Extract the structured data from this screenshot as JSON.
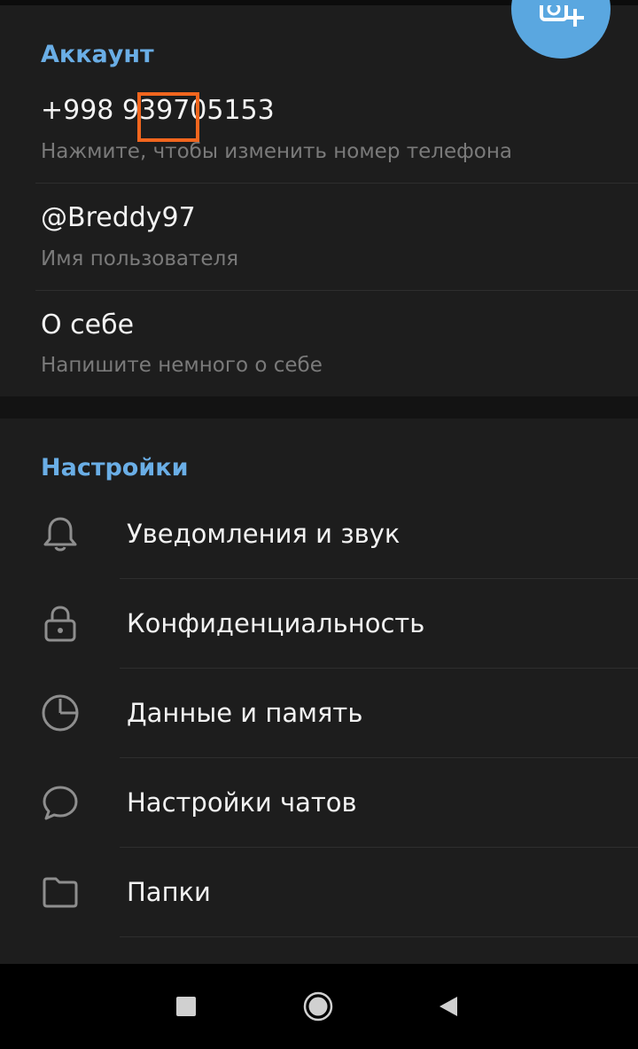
{
  "account": {
    "header": "Аккаунт",
    "phone": "+998 939705153",
    "phone_hint": "Нажмите, чтобы изменить номер телефона",
    "username": "@Breddy97",
    "username_hint": "Имя пользователя",
    "bio": "О себе",
    "bio_hint": "Напишите немного о себе"
  },
  "fab": {
    "icon": "add-photo-icon"
  },
  "settings": {
    "header": "Настройки",
    "items": [
      {
        "label": "Уведомления и звук",
        "icon": "bell-icon"
      },
      {
        "label": "Конфиденциальность",
        "icon": "lock-icon"
      },
      {
        "label": "Данные и память",
        "icon": "clock-icon"
      },
      {
        "label": "Настройки чатов",
        "icon": "chat-bubble-icon"
      },
      {
        "label": "Папки",
        "icon": "folder-icon"
      }
    ]
  },
  "navbar": {
    "buttons": [
      "recents-button",
      "home-button",
      "back-button"
    ]
  },
  "colors": {
    "accent": "#6aaee6",
    "fab": "#5aa7e0",
    "highlight": "#f2661e",
    "background": "#1d1d1d"
  }
}
